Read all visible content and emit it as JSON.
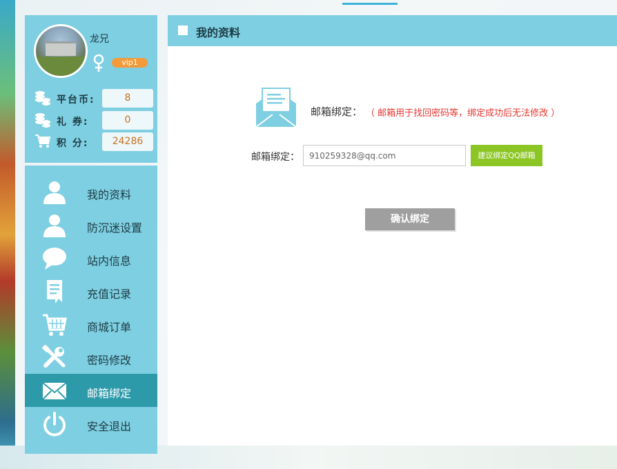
{
  "user": {
    "name": "龙兄",
    "vip_level": "vip1",
    "avatar_icon": "user-avatar-campus-photo"
  },
  "stats": [
    {
      "label": "平台币:",
      "value": "8",
      "icon": "coins-icon"
    },
    {
      "label": "礼 券:",
      "value": "0",
      "icon": "coupon-coins-icon"
    },
    {
      "label": "积 分:",
      "value": "24286",
      "icon": "cart-icon"
    }
  ],
  "menu": [
    {
      "label": "我的资料",
      "icon": "user-icon",
      "active": false
    },
    {
      "label": "防沉迷设置",
      "icon": "user-icon",
      "active": false
    },
    {
      "label": "站内信息",
      "icon": "chat-bubble-icon",
      "active": false
    },
    {
      "label": "充值记录",
      "icon": "document-icon",
      "active": false
    },
    {
      "label": "商城订单",
      "icon": "shopping-cart-icon",
      "active": false
    },
    {
      "label": "密码修改",
      "icon": "tools-icon",
      "active": false
    },
    {
      "label": "邮箱绑定",
      "icon": "envelope-icon",
      "active": true
    },
    {
      "label": "安全退出",
      "icon": "power-icon",
      "active": false
    }
  ],
  "main": {
    "header_title": "我的资料",
    "bind_title": "邮箱绑定：",
    "bind_note": "（ 邮箱用于找回密码等，绑定成功后无法修改 ）",
    "email_label": "邮箱绑定：",
    "email_value": "910259328@qq.com",
    "suggest_button": "建议绑定QQ邮箱",
    "confirm_button": "确认绑定"
  },
  "colors": {
    "panel_blue": "#7ecfe2",
    "active_teal": "#2d9aaa",
    "suggest_green": "#8cc625",
    "confirm_gray": "#9f9f9f",
    "note_red": "#e8352e",
    "value_orange": "#c8721f"
  }
}
